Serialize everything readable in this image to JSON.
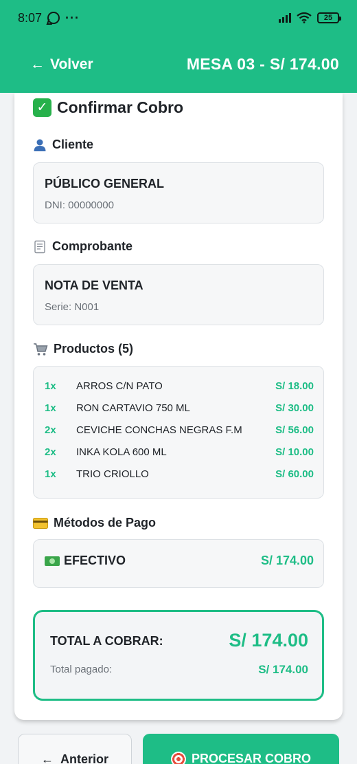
{
  "status_bar": {
    "time": "8:07",
    "dots": "···",
    "battery": "25"
  },
  "header": {
    "back_label": "Volver",
    "back_arrow": "←",
    "title": "MESA 03 - S/ 174.00"
  },
  "card": {
    "title": "Confirmar Cobro",
    "client": {
      "section_label": "Cliente",
      "name": "PÚBLICO GENERAL",
      "doc": "DNI: 00000000"
    },
    "voucher": {
      "section_label": "Comprobante",
      "type": "NOTA DE VENTA",
      "series": "Serie: N001"
    },
    "products": {
      "section_label": "Productos (5)",
      "items": [
        {
          "qty": "1x",
          "name": "ARROS C/N PATO",
          "price": "S/ 18.00"
        },
        {
          "qty": "1x",
          "name": "RON CARTAVIO 750 ML",
          "price": "S/ 30.00"
        },
        {
          "qty": "2x",
          "name": "CEVICHE CONCHAS NEGRAS F.M",
          "price": "S/ 56.00"
        },
        {
          "qty": "2x",
          "name": "INKA KOLA 600 ML",
          "price": "S/ 10.00"
        },
        {
          "qty": "1x",
          "name": "TRIO CRIOLLO",
          "price": "S/ 60.00"
        }
      ]
    },
    "payment": {
      "section_label": "Métodos de Pago",
      "method": "EFECTIVO",
      "amount": "S/ 174.00"
    },
    "total": {
      "label": "TOTAL A COBRAR:",
      "amount": "S/ 174.00",
      "paid_label": "Total pagado:",
      "paid_amount": "S/ 174.00"
    }
  },
  "footer": {
    "prev_arrow": "←",
    "prev_label": "Anterior",
    "process_label": "PROCESAR COBRO"
  },
  "colors": {
    "accent": "#1ebd86",
    "background": "#f1f3f5"
  },
  "icons": [
    "whatsapp-icon",
    "signal-icon",
    "wifi-icon",
    "battery-icon",
    "check-icon",
    "user-icon",
    "receipt-icon",
    "cart-icon",
    "card-icon",
    "cash-icon",
    "target-icon"
  ]
}
